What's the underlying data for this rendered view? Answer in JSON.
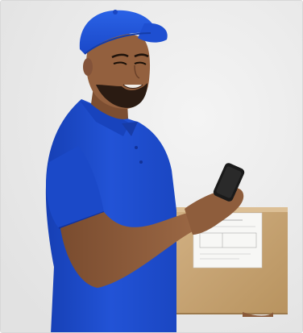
{
  "scene": {
    "background_color": "#ececec",
    "shirt_color": "#1f4fd0",
    "cap_color": "#2055d8",
    "box_color": "#c9a677",
    "label_color": "#f7f7f5",
    "skin_color": "#8a5a3a",
    "phone_color": "#1a1a1a"
  },
  "icons": {
    "cap": "cap-icon",
    "phone": "smartphone-icon",
    "parcel": "parcel-box-icon",
    "label": "shipping-label-icon"
  }
}
